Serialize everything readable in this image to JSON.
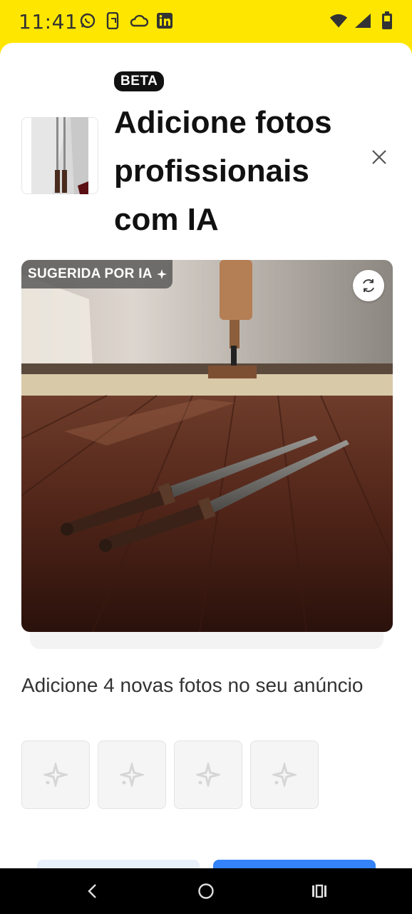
{
  "status_bar": {
    "time": "11:41",
    "left_icons": [
      "whatsapp-icon",
      "phone-sync-icon",
      "cloud-icon",
      "linkedin-icon"
    ],
    "right_icons": [
      "wifi-icon",
      "signal-icon",
      "battery-icon"
    ]
  },
  "sheet": {
    "badge": "BETA",
    "title": "Adicione fotos profissionais com IA",
    "close_icon": "close-icon",
    "photo": {
      "chip_label": "SUGERIDA POR IA",
      "chip_icon": "sparkle-icon",
      "refresh_icon": "refresh-icon"
    },
    "subtitle": "Adicione 4 novas fotos no seu anúncio",
    "slots": [
      {
        "icon": "sparkle-icon"
      },
      {
        "icon": "sparkle-icon"
      },
      {
        "icon": "sparkle-icon"
      },
      {
        "icon": "sparkle-icon"
      }
    ]
  },
  "colors": {
    "brand_yellow": "#ffe600",
    "primary_blue": "#3483fa",
    "secondary_blue": "#e8f0fc"
  },
  "nav_bar": {
    "icons": [
      "back-icon",
      "home-icon",
      "recents-icon"
    ]
  }
}
